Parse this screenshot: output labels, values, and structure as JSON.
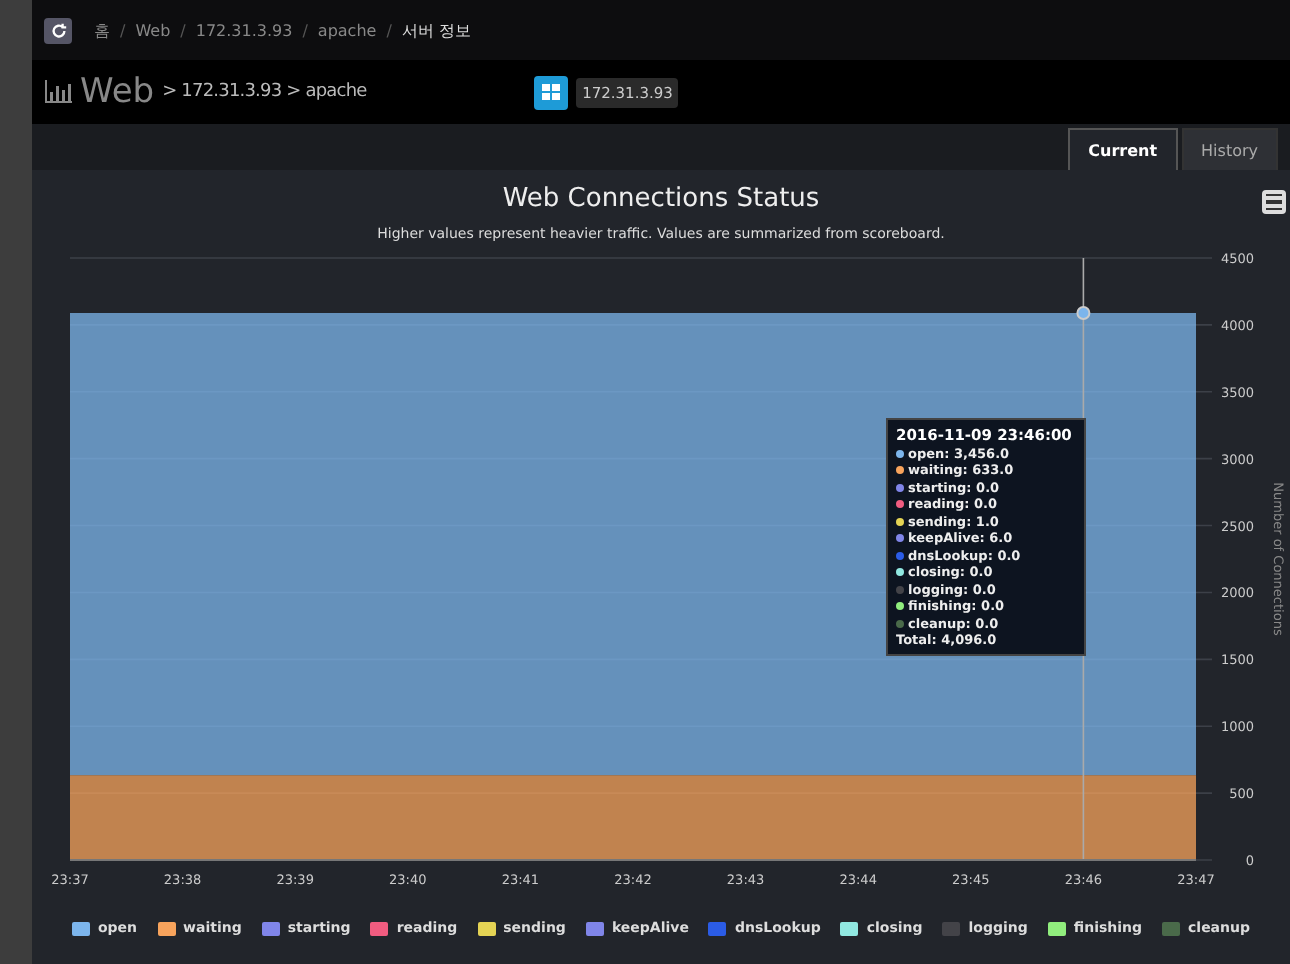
{
  "breadcrumb": [
    "홈",
    "Web",
    "172.31.3.93",
    "apache",
    "서버 정보"
  ],
  "breadcrumb_separator": "/",
  "header": {
    "title": "Web",
    "path": "> 172.31.3.93 > apache",
    "server_badge": "172.31.3.93"
  },
  "tabs": [
    {
      "label": "Current",
      "selected": true
    },
    {
      "label": "History",
      "selected": false
    }
  ],
  "chart": {
    "chart_data": {
      "type": "area",
      "title": "Web Connections Status",
      "subtitle": "Higher values represent heavier traffic. Values are summarized from scoreboard.",
      "ylabel": "Number of Connections",
      "stacked": true,
      "categories": [
        "23:37",
        "23:38",
        "23:39",
        "23:40",
        "23:41",
        "23:42",
        "23:43",
        "23:44",
        "23:45",
        "23:46",
        "23:47"
      ],
      "ylim": [
        0,
        4500
      ],
      "grid": true,
      "yticks": [
        0,
        500,
        1000,
        1500,
        2000,
        2500,
        3000,
        3500,
        4000,
        4500
      ],
      "series": [
        {
          "name": "cleanup",
          "color": "#4a6a4a",
          "values": [
            null,
            null,
            null,
            null,
            null,
            null,
            null,
            null,
            null,
            null,
            null
          ]
        },
        {
          "name": "finishing",
          "color": "#90ed7d",
          "values": [
            null,
            null,
            null,
            null,
            null,
            null,
            null,
            null,
            null,
            null,
            null
          ]
        },
        {
          "name": "logging",
          "color": "#434348",
          "values": [
            null,
            null,
            null,
            null,
            null,
            null,
            null,
            null,
            null,
            null,
            null
          ]
        },
        {
          "name": "closing",
          "color": "#91e8e1",
          "values": [
            null,
            null,
            null,
            null,
            null,
            null,
            null,
            null,
            null,
            null,
            null
          ]
        },
        {
          "name": "dnsLookup",
          "color": "#2b5ce6",
          "values": [
            null,
            null,
            null,
            null,
            null,
            null,
            null,
            null,
            null,
            null,
            null
          ]
        },
        {
          "name": "keepAlive",
          "color": "#8085e8",
          "values": [
            null,
            null,
            null,
            null,
            null,
            null,
            null,
            null,
            null,
            null,
            null
          ]
        },
        {
          "name": "sending",
          "color": "#e4d354",
          "values": [
            null,
            null,
            null,
            null,
            null,
            null,
            null,
            null,
            null,
            null,
            null
          ]
        },
        {
          "name": "reading",
          "color": "#f15c80",
          "values": [
            null,
            null,
            null,
            null,
            null,
            null,
            null,
            null,
            null,
            null,
            null
          ]
        },
        {
          "name": "starting",
          "color": "#8085e9",
          "values": [
            null,
            null,
            null,
            null,
            null,
            null,
            null,
            null,
            null,
            null,
            null
          ]
        },
        {
          "name": "waiting",
          "color": "#f7a35c",
          "values": [
            633,
            633,
            633,
            633,
            633,
            633,
            633,
            633,
            633,
            633,
            633
          ]
        },
        {
          "name": "open",
          "color": "#7cb5ec",
          "values": [
            3456,
            3456,
            3456,
            3456,
            3456,
            3456,
            3456,
            3456,
            3456,
            3456,
            3456
          ]
        }
      ],
      "ref_lines": [
        {
          "axis": "x",
          "value": "23:46"
        }
      ]
    },
    "tooltip": {
      "title": "2016-11-09 23:46:00",
      "rows": [
        {
          "text": "open: 3,456.0",
          "color": "#7cb5ec"
        },
        {
          "text": "waiting: 633.0",
          "color": "#f7a35c"
        },
        {
          "text": "starting: 0.0",
          "color": "#8085e9"
        },
        {
          "text": "reading: 0.0",
          "color": "#f15c80"
        },
        {
          "text": "sending: 1.0",
          "color": "#e4d354"
        },
        {
          "text": "keepAlive: 6.0",
          "color": "#8085e8"
        },
        {
          "text": "dnsLookup: 0.0",
          "color": "#2b5ce6"
        },
        {
          "text": "closing: 0.0",
          "color": "#91e8e1"
        },
        {
          "text": "logging: 0.0",
          "color": "#434348"
        },
        {
          "text": "finishing: 0.0",
          "color": "#90ed7d"
        },
        {
          "text": "cleanup: 0.0",
          "color": "#4a6a4a"
        }
      ],
      "total": "Total: 4,096.0"
    }
  }
}
